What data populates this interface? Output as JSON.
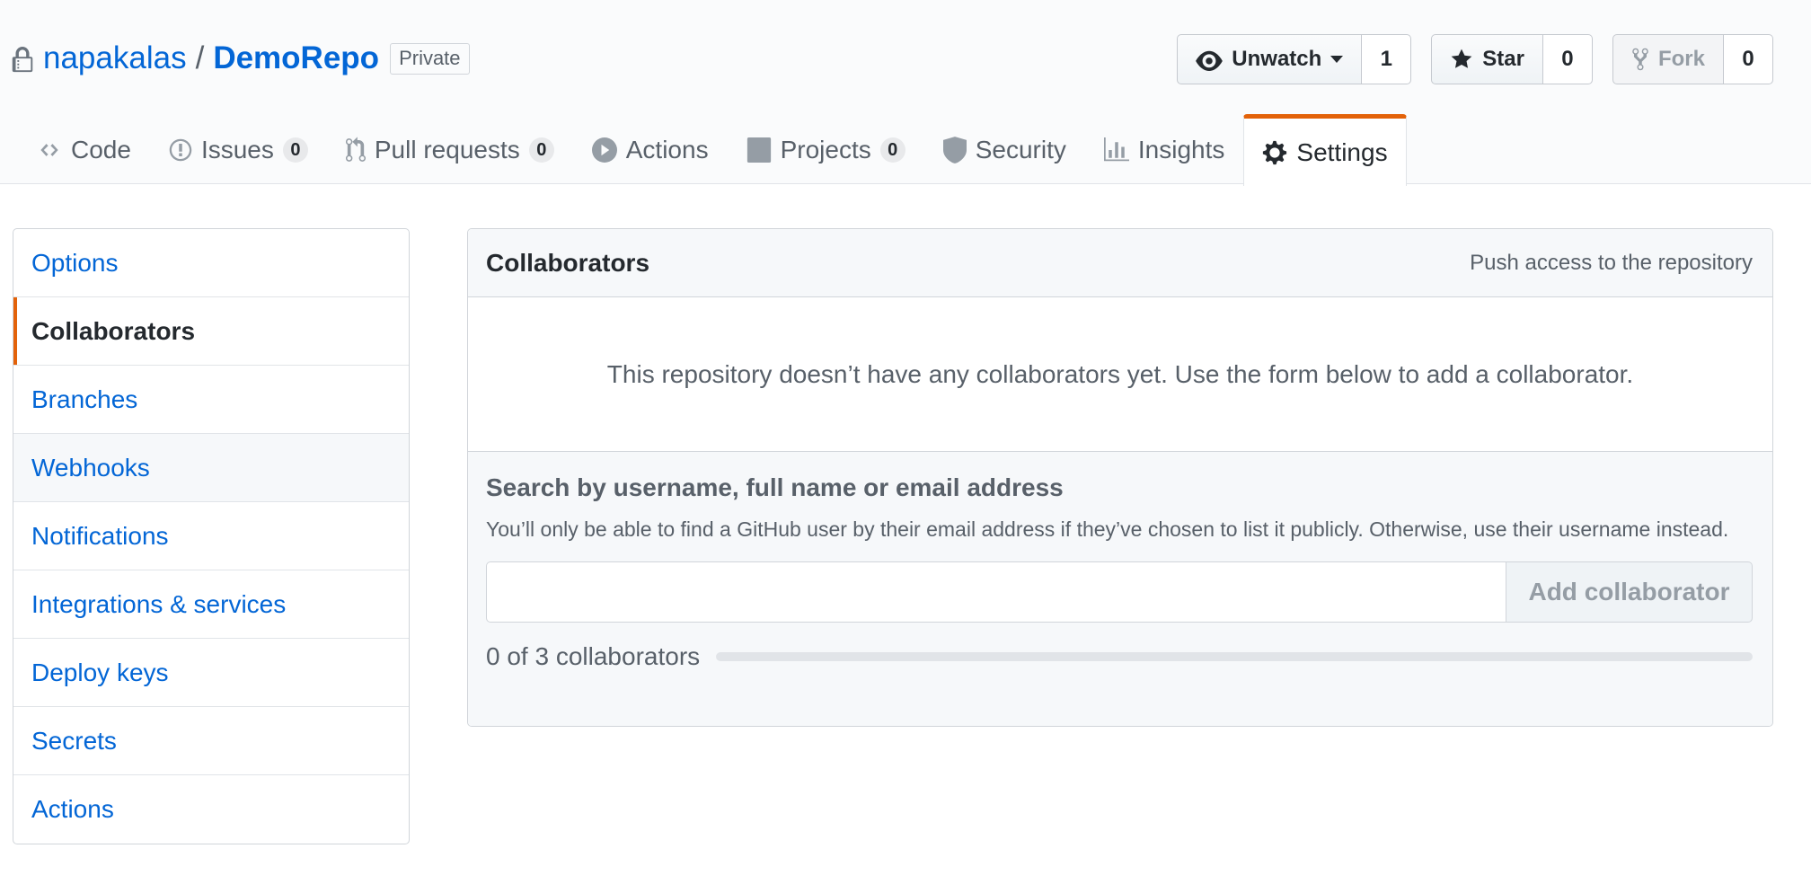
{
  "repo": {
    "owner": "napakalas",
    "separator": "/",
    "name": "DemoRepo",
    "visibility": "Private"
  },
  "actions": {
    "watch": {
      "label": "Unwatch",
      "count": "1",
      "icon": "eye-icon"
    },
    "star": {
      "label": "Star",
      "count": "0",
      "icon": "star-icon"
    },
    "fork": {
      "label": "Fork",
      "count": "0",
      "icon": "fork-icon"
    }
  },
  "tabs": [
    {
      "label": "Code",
      "icon": "code-icon"
    },
    {
      "label": "Issues",
      "counter": "0",
      "icon": "issue-icon"
    },
    {
      "label": "Pull requests",
      "counter": "0",
      "icon": "pull-request-icon"
    },
    {
      "label": "Actions",
      "icon": "play-icon"
    },
    {
      "label": "Projects",
      "counter": "0",
      "icon": "project-icon"
    },
    {
      "label": "Security",
      "icon": "shield-icon"
    },
    {
      "label": "Insights",
      "icon": "graph-icon"
    },
    {
      "label": "Settings",
      "icon": "gear-icon",
      "selected": true
    }
  ],
  "menu": [
    "Options",
    "Collaborators",
    "Branches",
    "Webhooks",
    "Notifications",
    "Integrations & services",
    "Deploy keys",
    "Secrets",
    "Actions"
  ],
  "collaborators": {
    "title": "Collaborators",
    "note": "Push access to the repository",
    "empty_message": "This repository doesn’t have any collaborators yet. Use the form below to add a collaborator.",
    "search_label": "Search by username, full name or email address",
    "search_note": "You’ll only be able to find a GitHub user by their email address if they’ve chosen to list it publicly. Otherwise, use their username instead.",
    "input_value": "",
    "add_button": "Add collaborator",
    "progress_text": "0 of 3 collaborators",
    "progress_fraction": 0
  },
  "colors": {
    "link": "#0366d6",
    "selected_accent": "#e36209",
    "muted": "#586069"
  }
}
